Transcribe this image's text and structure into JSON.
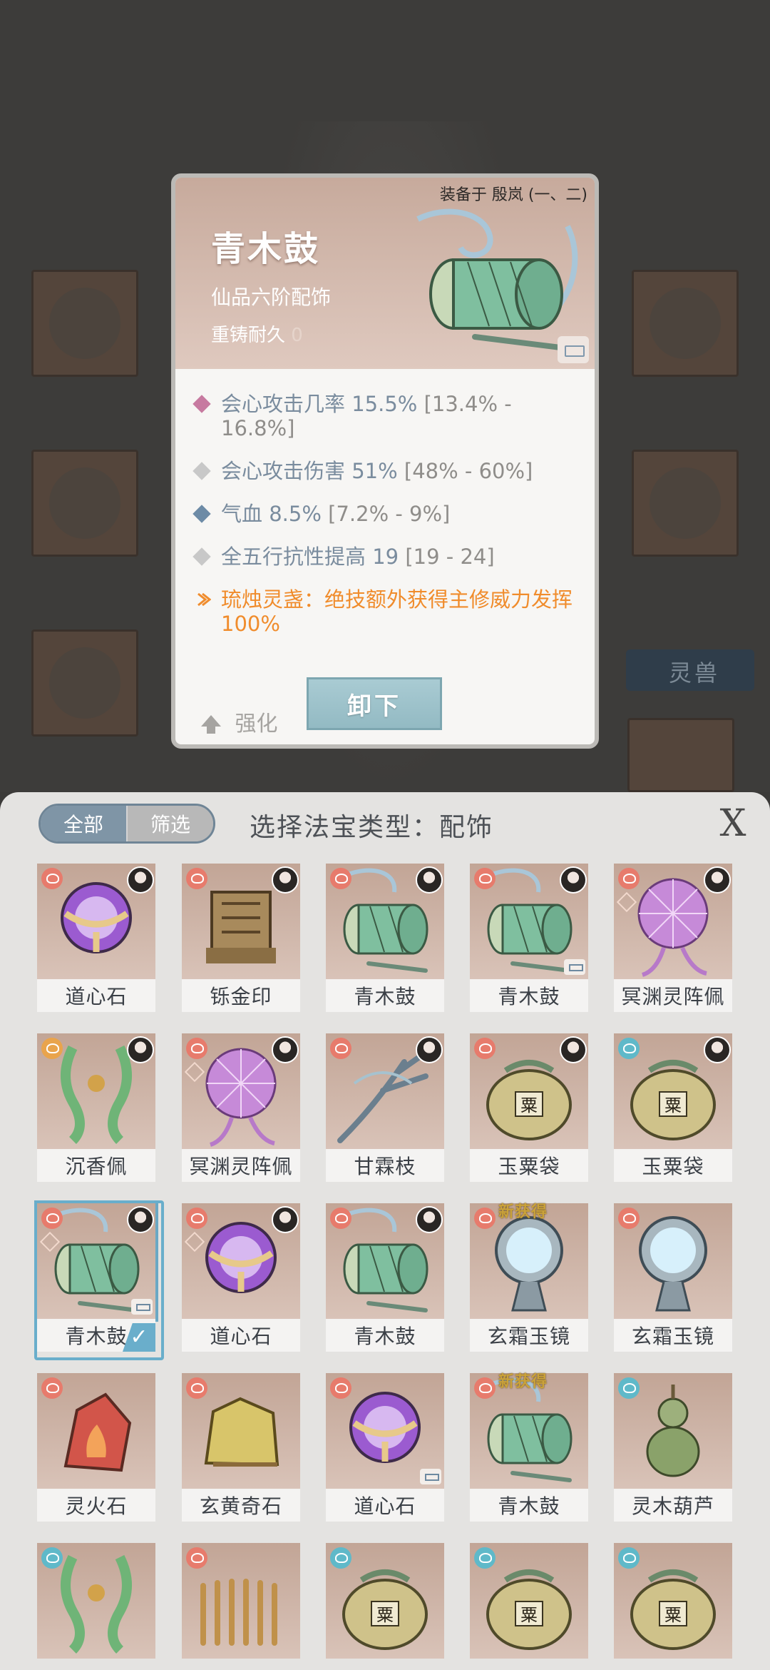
{
  "popup": {
    "equipped_by": "装备于 殷岚 (一、二)",
    "name": "青木鼓",
    "grade": "仙品六阶配饰",
    "durability_label": "重铸耐久",
    "durability_value": "0",
    "stats": [
      {
        "name": "会心攻击几率",
        "value": "15.5%",
        "range": "[13.4% - 16.8%]",
        "icon_color": "#c77aa0"
      },
      {
        "name": "会心攻击伤害",
        "value": "51%",
        "range": "[48% - 60%]",
        "icon_color": "#c8c8c8"
      },
      {
        "name": "气血",
        "value": "8.5%",
        "range": "[7.2% - 9%]",
        "icon_color": "#6d8ba6"
      },
      {
        "name": "全五行抗性提高",
        "value": "19",
        "range": "[19 - 24]",
        "icon_color": "#c8c8c8"
      }
    ],
    "special_effect": "琉烛灵盏：绝技额外获得主修威力发挥100%",
    "strengthen_label": "强化",
    "unequip_label": "卸下"
  },
  "background": {
    "beast_label": "灵兽"
  },
  "sheet": {
    "tab_all": "全部",
    "tab_filter": "筛选",
    "title": "选择法宝类型：配饰",
    "close_label": "X",
    "items": [
      {
        "label": "道心石",
        "type": "orb",
        "elem": "#e77b6c",
        "avatar": true,
        "lock": false,
        "suit": false,
        "new": false
      },
      {
        "label": "铄金印",
        "type": "seal",
        "elem": "#e77b6c",
        "avatar": true,
        "lock": false,
        "suit": false,
        "new": false
      },
      {
        "label": "青木鼓",
        "type": "drum",
        "elem": "#e77b6c",
        "avatar": true,
        "lock": false,
        "suit": false,
        "new": false
      },
      {
        "label": "青木鼓",
        "type": "drum",
        "elem": "#e77b6c",
        "avatar": true,
        "lock": true,
        "suit": false,
        "new": false
      },
      {
        "label": "冥渊灵阵佩",
        "type": "web",
        "elem": "#e77b6c",
        "avatar": true,
        "lock": false,
        "suit": true,
        "new": false
      },
      {
        "label": "沉香佩",
        "type": "pendant",
        "elem": "#e9a44c",
        "avatar": true,
        "lock": false,
        "suit": false,
        "new": false
      },
      {
        "label": "冥渊灵阵佩",
        "type": "web",
        "elem": "#e77b6c",
        "avatar": true,
        "lock": false,
        "suit": true,
        "new": false
      },
      {
        "label": "甘霖枝",
        "type": "branch",
        "elem": "#e77b6c",
        "avatar": true,
        "lock": false,
        "suit": false,
        "new": false
      },
      {
        "label": "玉粟袋",
        "type": "bag",
        "elem": "#e77b6c",
        "avatar": true,
        "lock": false,
        "suit": false,
        "new": false
      },
      {
        "label": "玉粟袋",
        "type": "bag",
        "elem": "#5fb9c9",
        "avatar": true,
        "lock": false,
        "suit": false,
        "new": false
      },
      {
        "label": "青木鼓",
        "type": "drum",
        "elem": "#e77b6c",
        "avatar": true,
        "lock": true,
        "suit": true,
        "new": false,
        "selected": true
      },
      {
        "label": "道心石",
        "type": "orb",
        "elem": "#e77b6c",
        "avatar": true,
        "lock": false,
        "suit": true,
        "new": false
      },
      {
        "label": "青木鼓",
        "type": "drum",
        "elem": "#e77b6c",
        "avatar": true,
        "lock": false,
        "suit": false,
        "new": false
      },
      {
        "label": "玄霜玉镜",
        "type": "mirror",
        "elem": "#e77b6c",
        "avatar": false,
        "lock": false,
        "suit": false,
        "new": true
      },
      {
        "label": "玄霜玉镜",
        "type": "mirror",
        "elem": "#e77b6c",
        "avatar": false,
        "lock": false,
        "suit": false,
        "new": false
      },
      {
        "label": "灵火石",
        "type": "fire",
        "elem": "#e77b6c",
        "avatar": false,
        "lock": false,
        "suit": false,
        "new": false
      },
      {
        "label": "玄黄奇石",
        "type": "rock",
        "elem": "#e77b6c",
        "avatar": false,
        "lock": false,
        "suit": false,
        "new": false
      },
      {
        "label": "道心石",
        "type": "orb",
        "elem": "#e77b6c",
        "avatar": false,
        "lock": true,
        "suit": false,
        "new": false
      },
      {
        "label": "青木鼓",
        "type": "drum",
        "elem": "#e77b6c",
        "avatar": false,
        "lock": false,
        "suit": false,
        "new": true
      },
      {
        "label": "灵木葫芦",
        "type": "gourd",
        "elem": "#5fb9c9",
        "avatar": false,
        "lock": false,
        "suit": false,
        "new": false
      },
      {
        "label": "",
        "type": "pendant",
        "elem": "#5fb9c9",
        "avatar": false,
        "lock": false,
        "suit": false,
        "new": false
      },
      {
        "label": "",
        "type": "coil",
        "elem": "#e77b6c",
        "avatar": false,
        "lock": false,
        "suit": false,
        "new": false
      },
      {
        "label": "",
        "type": "bag",
        "elem": "#5fb9c9",
        "avatar": false,
        "lock": false,
        "suit": false,
        "new": false
      },
      {
        "label": "",
        "type": "bag",
        "elem": "#5fb9c9",
        "avatar": false,
        "lock": false,
        "suit": false,
        "new": false
      },
      {
        "label": "",
        "type": "bag",
        "elem": "#5fb9c9",
        "avatar": false,
        "lock": false,
        "suit": false,
        "new": false
      }
    ],
    "new_tag": "新获得",
    "bag_glyph": "粟"
  }
}
